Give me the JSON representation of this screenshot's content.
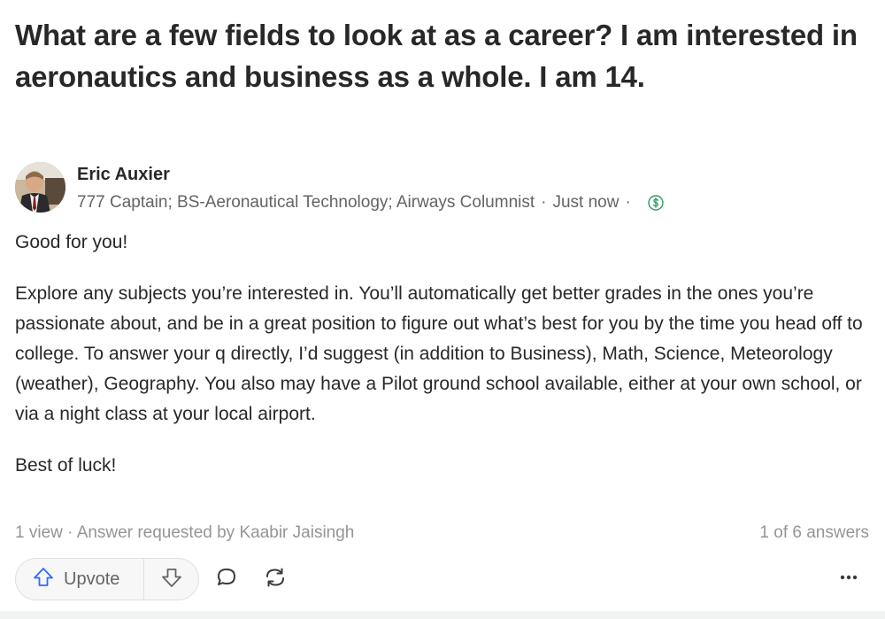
{
  "question": {
    "title": "What are a few fields to look at as a career? I am interested in aeronautics and business as a whole. I am 14."
  },
  "author": {
    "name": "Eric Auxier",
    "credential": "777 Captain; BS-Aeronautical Technology; Airways Columnist",
    "separator": "·",
    "timestamp": "Just now",
    "monetization_icon": "dollar-circle-icon"
  },
  "answer": {
    "paragraphs": [
      "Good for you!",
      "Explore any subjects you’re interested in. You’ll automatically get better grades in the ones you’re passionate about, and be in a great position to figure out what’s best for you by the time you head off to college. To answer your q directly, I’d suggest (in addition to Business), Math, Science, Meteorology (weather), Geography. You also may have a Pilot ground school available, either at your own school, or via a night class at your local airport.",
      "Best of luck!"
    ]
  },
  "footer": {
    "meta": "1 view · Answer requested by Kaabir Jaisingh",
    "answer_count": "1 of 6 answers"
  },
  "actions": {
    "upvote_label": "Upvote",
    "upvote_icon": "arrow-up-icon",
    "downvote_icon": "arrow-down-icon",
    "comment_icon": "comment-icon",
    "share_icon": "share-icon",
    "more_icon": "more-icon"
  },
  "colors": {
    "text": "#282829",
    "secondary": "#636466",
    "muted": "#939598",
    "money_green": "#2e9e62",
    "icon_blue": "#2e69ff"
  }
}
